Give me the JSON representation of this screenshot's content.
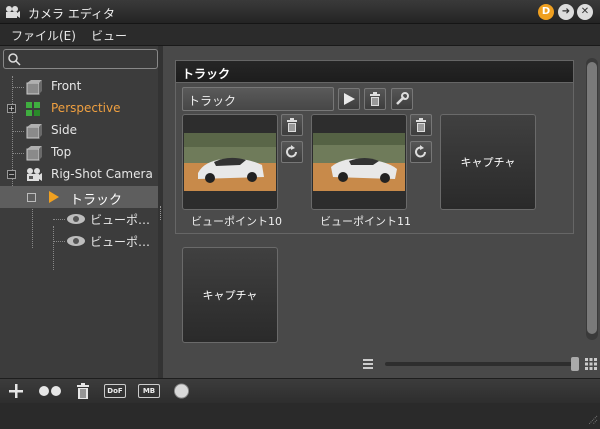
{
  "window": {
    "title": "カメラ エディタ",
    "help_badge": "D",
    "accent_color": "#f0a020"
  },
  "menubar": {
    "items": [
      "ファイル(E)",
      "ビュー"
    ]
  },
  "search": {
    "placeholder": ""
  },
  "tree": {
    "items": [
      {
        "label": "Front",
        "icon": "camera-box-icon",
        "color": "#e6e6e6"
      },
      {
        "label": "Perspective",
        "icon": "perspective-camera-icon",
        "color": "#f0a040"
      },
      {
        "label": "Side",
        "icon": "camera-box-icon",
        "color": "#e6e6e6"
      },
      {
        "label": "Top",
        "icon": "camera-box-icon",
        "color": "#e6e6e6"
      },
      {
        "label": "Rig-Shot Camera",
        "icon": "rig-camera-icon",
        "color": "#e6e6e6"
      },
      {
        "label": "トラック",
        "icon": "play-track-icon",
        "color": "#ffffff"
      },
      {
        "label": "ビューポ…",
        "icon": "eye-icon",
        "color": "#e6e6e6"
      },
      {
        "label": "ビューポ…",
        "icon": "eye-icon",
        "color": "#e6e6e6"
      }
    ]
  },
  "track_group": {
    "title": "トラック",
    "selected_track": "トラック",
    "viewpoints": [
      {
        "label": "ビューポイント10"
      },
      {
        "label": "ビューポイント11"
      }
    ],
    "capture_label": "キャプチャ"
  },
  "capture_standalone": {
    "label": "キャプチャ"
  },
  "zoom": {
    "value": 1.0
  },
  "bottom_toolbar": {
    "dof_label": "DoF",
    "mb_label": "MB"
  }
}
